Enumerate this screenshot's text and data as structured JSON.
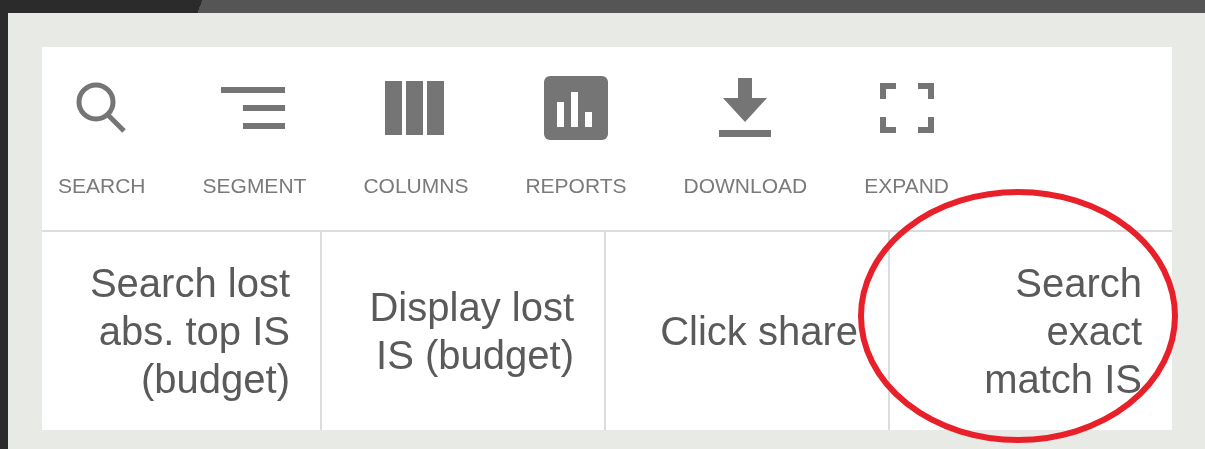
{
  "toolbar": {
    "buttons": [
      {
        "label": "SEARCH",
        "kind": "search"
      },
      {
        "label": "SEGMENT",
        "kind": "segment"
      },
      {
        "label": "COLUMNS",
        "kind": "columns"
      },
      {
        "label": "REPORTS",
        "kind": "reports"
      },
      {
        "label": "DOWNLOAD",
        "kind": "download"
      },
      {
        "label": "EXPAND",
        "kind": "expand"
      }
    ]
  },
  "table": {
    "columns": [
      {
        "label": "Search lost abs. top IS (budget)",
        "highlighted": false
      },
      {
        "label": "Display lost IS (budget)",
        "highlighted": false
      },
      {
        "label": "Click share",
        "highlighted": false
      },
      {
        "label": "Search exact match IS",
        "highlighted": true
      }
    ]
  }
}
